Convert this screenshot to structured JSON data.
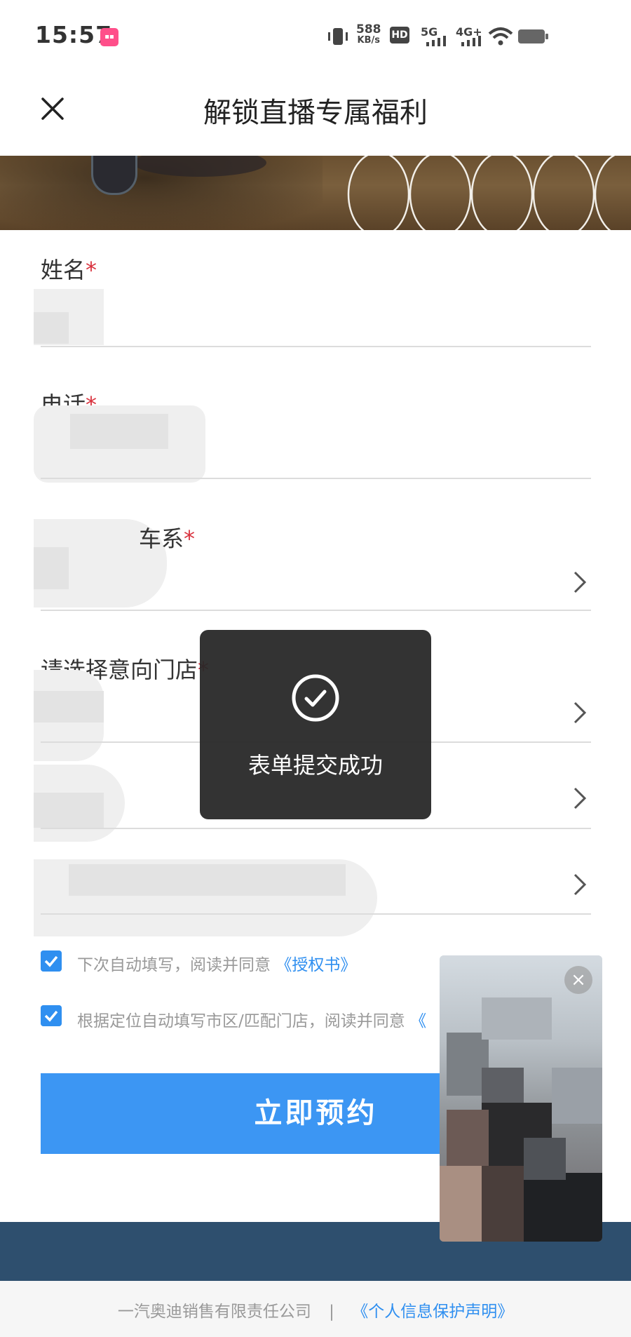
{
  "status_bar": {
    "time": "15:57",
    "net_speed_value": "588",
    "net_speed_unit": "KB/s",
    "hd_label": "HD",
    "signal_1": "5G",
    "signal_2": "4G+"
  },
  "header": {
    "title": "解锁直播专属福利"
  },
  "form": {
    "name_label": "姓名",
    "phone_label": "电话",
    "series_label": "车系",
    "store_label": "请选择意向门店",
    "required_mark": "*"
  },
  "consent": {
    "item1_text": "下次自动填写，阅读并同意",
    "item1_link": "《授权书》",
    "item2_text": "根据定位自动填写市区/匹配门店，阅读并同意",
    "item2_link": "《"
  },
  "submit_label": "立即预约",
  "toast": {
    "message": "表单提交成功"
  },
  "footer": {
    "company": "一汽奥迪销售有限责任公司",
    "separator": "|",
    "privacy_link": "《个人信息保护声明》"
  },
  "colors": {
    "accent": "#3c96f3",
    "required": "#d9333f",
    "toast_bg": "#282828",
    "footer_band": "#2e4f6e"
  }
}
